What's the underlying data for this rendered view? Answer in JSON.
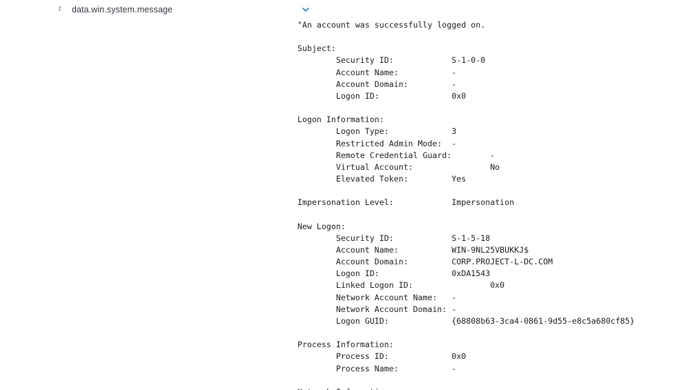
{
  "field": {
    "type_glyph": "t",
    "name": "data.win.system.message",
    "toggle_icon": "chevron-down-icon",
    "value": "\"An account was successfully logged on.\n\nSubject:\n\tSecurity ID:\t\tS-1-0-0\n\tAccount Name:\t\t-\n\tAccount Domain:\t\t-\n\tLogon ID:\t\t0x0\n\nLogon Information:\n\tLogon Type:\t\t3\n\tRestricted Admin Mode:\t-\n\tRemote Credential Guard:\t-\n\tVirtual Account:\t\tNo\n\tElevated Token:\t\tYes\n\nImpersonation Level:\t\tImpersonation\n\nNew Logon:\n\tSecurity ID:\t\tS-1-5-18\n\tAccount Name:\t\tWIN-9NL25VBUKKJ$\n\tAccount Domain:\t\tCORP.PROJECT-L-DC.COM\n\tLogon ID:\t\t0xDA1543\n\tLinked Logon ID:\t\t0x0\n\tNetwork Account Name:\t-\n\tNetwork Account Domain:\t-\n\tLogon GUID:\t\t{68808b63-3ca4-0861-9d55-e8c5a680cf85}\n\nProcess Information:\n\tProcess ID:\t\t0x0\n\tProcess Name:\t\t-\n\nNetwork Information:"
  },
  "colors": {
    "accent": "#006bb8",
    "text": "#1a1c21",
    "muted": "#69707d"
  }
}
